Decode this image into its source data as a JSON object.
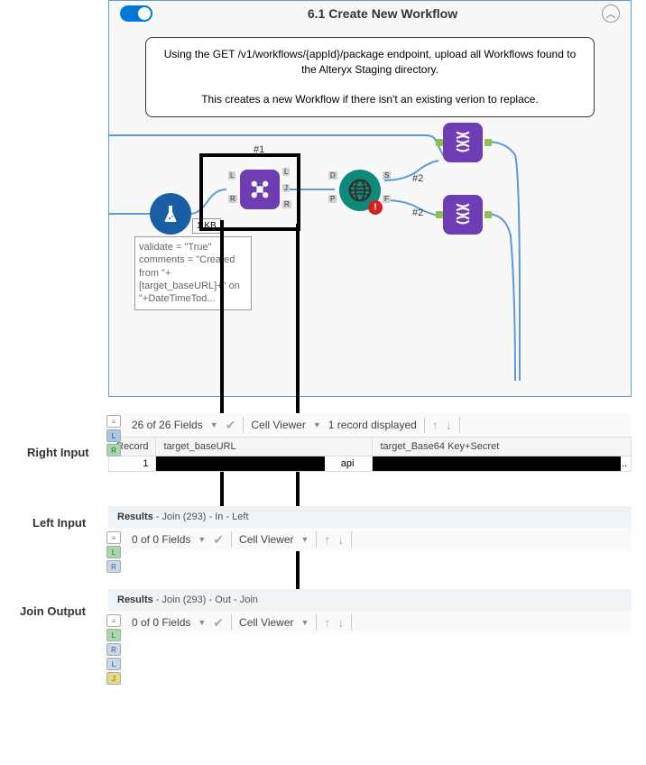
{
  "header": {
    "title": "6.1 Create New Workflow"
  },
  "description": {
    "line1": "Using the GET /v1/workflows/{appId}/package endpoint, upload all Workflows found to the Alteryx Staging directory.",
    "line2": "This creates a new Workflow if there isn't an existing verion to replace."
  },
  "labels": {
    "hash1": "#1",
    "hash2a": "#2",
    "hash2b": "#2",
    "kb": "1 KB",
    "right_input": "Right Input",
    "left_input": "Left Input",
    "join_output": "Join Output"
  },
  "formula": {
    "text": "validate = \"True\"\ncomments = \"Created from \"+[target_baseURL]+\" on \"+DateTimeTod..."
  },
  "right_panel": {
    "fields": "26 of 26 Fields",
    "cell_viewer": "Cell Viewer",
    "records": "1 record displayed",
    "columns": {
      "record": "Record",
      "col1": "target_baseURL",
      "col2": "target_Base64 Key+Secret"
    },
    "row1": {
      "record": "1",
      "api_text": "api",
      "ellipsis": "..."
    }
  },
  "left_panel": {
    "header": "Results - Join (293) - In - Left",
    "fields": "0 of 0 Fields",
    "cell_viewer": "Cell Viewer"
  },
  "join_panel": {
    "header": "Results - Join (293) - Out - Join",
    "fields": "0 of 0 Fields",
    "cell_viewer": "Cell Viewer"
  },
  "icons": {
    "join": "join-icon",
    "flask": "flask-icon",
    "globe": "globe-icon",
    "dna": "dna-icon"
  }
}
